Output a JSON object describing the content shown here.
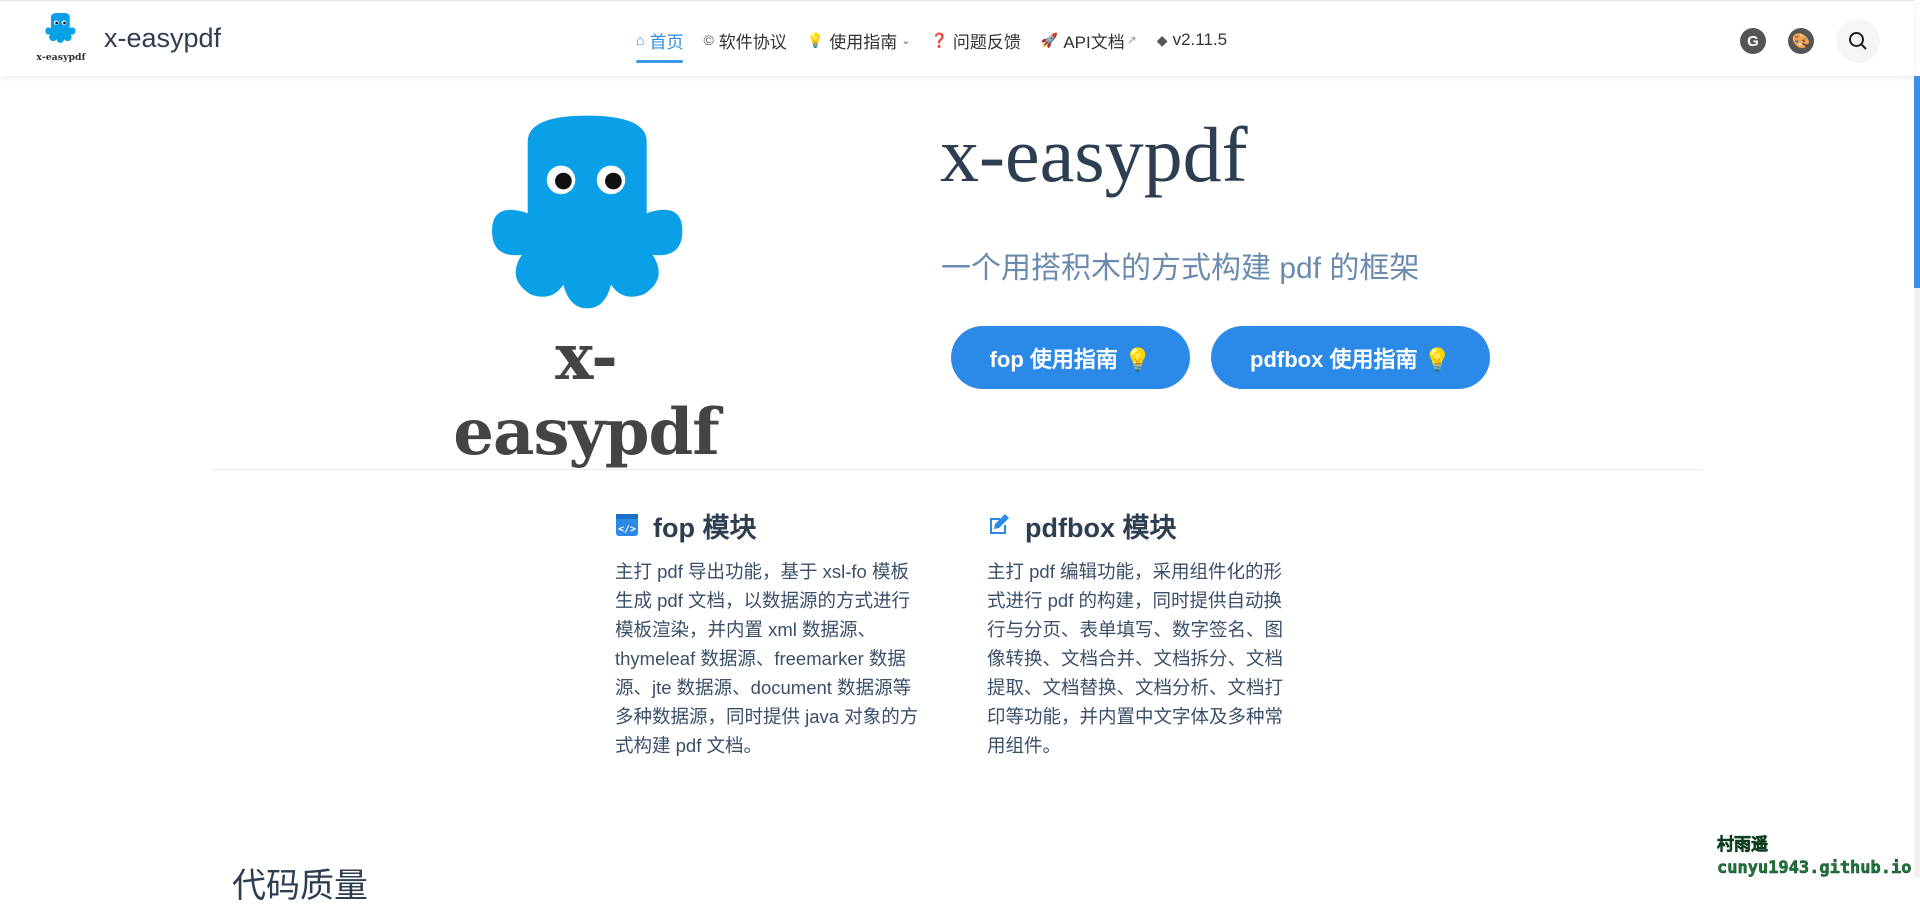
{
  "navbar": {
    "brand": "x-easypdf",
    "brand_logo_text": "x-easypdf",
    "links": [
      {
        "label": "首页",
        "icon": "home-icon",
        "active": true
      },
      {
        "label": "软件协议",
        "icon": "copyright-icon"
      },
      {
        "label": "使用指南",
        "icon": "lightbulb-icon",
        "dropdown": true
      },
      {
        "label": "问题反馈",
        "icon": "question-icon"
      },
      {
        "label": "API文档",
        "icon": "rocket-icon",
        "external": true
      },
      {
        "label": "v2.11.5",
        "icon": "tag-icon"
      }
    ],
    "right_icons": [
      "gitee-icon",
      "palette-icon",
      "search-icon"
    ]
  },
  "hero": {
    "logo_text": "x-easypdf",
    "title": "x-easypdf",
    "subtitle": "一个用搭积木的方式构建 pdf 的框架",
    "buttons": [
      {
        "label": "fop 使用指南 💡"
      },
      {
        "label": "pdfbox 使用指南 💡"
      }
    ]
  },
  "features": [
    {
      "title": "fop 模块",
      "icon": "code-window-icon",
      "details": "主打 pdf 导出功能，基于 xsl-fo 模板生成 pdf 文档，以数据源的方式进行模板渲染，并内置 xml 数据源、thymeleaf 数据源、freemarker 数据源、jte 数据源、document 数据源等多种数据源，同时提供 java 对象的方式构建 pdf 文档。"
    },
    {
      "title": "pdfbox 模块",
      "icon": "edit-icon",
      "details": "主打 pdf 编辑功能，采用组件化的形式进行 pdf 的构建，同时提供自动换行与分页、表单填写、数字签名、图像转换、文档合并、文档拆分、文档提取、文档替换、文档分析、文档打印等功能，并内置中文字体及多种常用组件。"
    }
  ],
  "next_section_heading": "代码质量",
  "watermark": {
    "name": "村雨遥",
    "site": "cunyu1943.github.io"
  },
  "colors": {
    "accent": "#2b8ae8",
    "text": "#2c3e50",
    "octopus": "#0aa0e8"
  }
}
